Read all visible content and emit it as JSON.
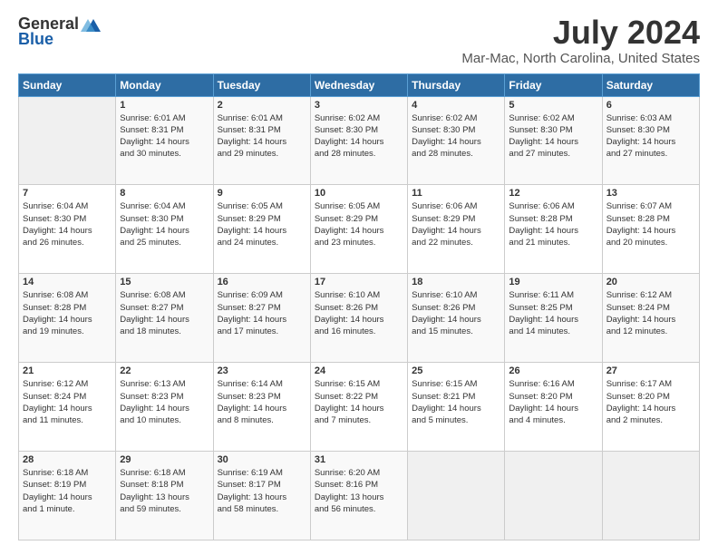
{
  "logo": {
    "general": "General",
    "blue": "Blue"
  },
  "title": "July 2024",
  "subtitle": "Mar-Mac, North Carolina, United States",
  "headers": [
    "Sunday",
    "Monday",
    "Tuesday",
    "Wednesday",
    "Thursday",
    "Friday",
    "Saturday"
  ],
  "weeks": [
    [
      {
        "day": "",
        "info": ""
      },
      {
        "day": "1",
        "info": "Sunrise: 6:01 AM\nSunset: 8:31 PM\nDaylight: 14 hours\nand 30 minutes."
      },
      {
        "day": "2",
        "info": "Sunrise: 6:01 AM\nSunset: 8:31 PM\nDaylight: 14 hours\nand 29 minutes."
      },
      {
        "day": "3",
        "info": "Sunrise: 6:02 AM\nSunset: 8:30 PM\nDaylight: 14 hours\nand 28 minutes."
      },
      {
        "day": "4",
        "info": "Sunrise: 6:02 AM\nSunset: 8:30 PM\nDaylight: 14 hours\nand 28 minutes."
      },
      {
        "day": "5",
        "info": "Sunrise: 6:02 AM\nSunset: 8:30 PM\nDaylight: 14 hours\nand 27 minutes."
      },
      {
        "day": "6",
        "info": "Sunrise: 6:03 AM\nSunset: 8:30 PM\nDaylight: 14 hours\nand 27 minutes."
      }
    ],
    [
      {
        "day": "7",
        "info": "Sunrise: 6:04 AM\nSunset: 8:30 PM\nDaylight: 14 hours\nand 26 minutes."
      },
      {
        "day": "8",
        "info": "Sunrise: 6:04 AM\nSunset: 8:30 PM\nDaylight: 14 hours\nand 25 minutes."
      },
      {
        "day": "9",
        "info": "Sunrise: 6:05 AM\nSunset: 8:29 PM\nDaylight: 14 hours\nand 24 minutes."
      },
      {
        "day": "10",
        "info": "Sunrise: 6:05 AM\nSunset: 8:29 PM\nDaylight: 14 hours\nand 23 minutes."
      },
      {
        "day": "11",
        "info": "Sunrise: 6:06 AM\nSunset: 8:29 PM\nDaylight: 14 hours\nand 22 minutes."
      },
      {
        "day": "12",
        "info": "Sunrise: 6:06 AM\nSunset: 8:28 PM\nDaylight: 14 hours\nand 21 minutes."
      },
      {
        "day": "13",
        "info": "Sunrise: 6:07 AM\nSunset: 8:28 PM\nDaylight: 14 hours\nand 20 minutes."
      }
    ],
    [
      {
        "day": "14",
        "info": "Sunrise: 6:08 AM\nSunset: 8:28 PM\nDaylight: 14 hours\nand 19 minutes."
      },
      {
        "day": "15",
        "info": "Sunrise: 6:08 AM\nSunset: 8:27 PM\nDaylight: 14 hours\nand 18 minutes."
      },
      {
        "day": "16",
        "info": "Sunrise: 6:09 AM\nSunset: 8:27 PM\nDaylight: 14 hours\nand 17 minutes."
      },
      {
        "day": "17",
        "info": "Sunrise: 6:10 AM\nSunset: 8:26 PM\nDaylight: 14 hours\nand 16 minutes."
      },
      {
        "day": "18",
        "info": "Sunrise: 6:10 AM\nSunset: 8:26 PM\nDaylight: 14 hours\nand 15 minutes."
      },
      {
        "day": "19",
        "info": "Sunrise: 6:11 AM\nSunset: 8:25 PM\nDaylight: 14 hours\nand 14 minutes."
      },
      {
        "day": "20",
        "info": "Sunrise: 6:12 AM\nSunset: 8:24 PM\nDaylight: 14 hours\nand 12 minutes."
      }
    ],
    [
      {
        "day": "21",
        "info": "Sunrise: 6:12 AM\nSunset: 8:24 PM\nDaylight: 14 hours\nand 11 minutes."
      },
      {
        "day": "22",
        "info": "Sunrise: 6:13 AM\nSunset: 8:23 PM\nDaylight: 14 hours\nand 10 minutes."
      },
      {
        "day": "23",
        "info": "Sunrise: 6:14 AM\nSunset: 8:23 PM\nDaylight: 14 hours\nand 8 minutes."
      },
      {
        "day": "24",
        "info": "Sunrise: 6:15 AM\nSunset: 8:22 PM\nDaylight: 14 hours\nand 7 minutes."
      },
      {
        "day": "25",
        "info": "Sunrise: 6:15 AM\nSunset: 8:21 PM\nDaylight: 14 hours\nand 5 minutes."
      },
      {
        "day": "26",
        "info": "Sunrise: 6:16 AM\nSunset: 8:20 PM\nDaylight: 14 hours\nand 4 minutes."
      },
      {
        "day": "27",
        "info": "Sunrise: 6:17 AM\nSunset: 8:20 PM\nDaylight: 14 hours\nand 2 minutes."
      }
    ],
    [
      {
        "day": "28",
        "info": "Sunrise: 6:18 AM\nSunset: 8:19 PM\nDaylight: 14 hours\nand 1 minute."
      },
      {
        "day": "29",
        "info": "Sunrise: 6:18 AM\nSunset: 8:18 PM\nDaylight: 13 hours\nand 59 minutes."
      },
      {
        "day": "30",
        "info": "Sunrise: 6:19 AM\nSunset: 8:17 PM\nDaylight: 13 hours\nand 58 minutes."
      },
      {
        "day": "31",
        "info": "Sunrise: 6:20 AM\nSunset: 8:16 PM\nDaylight: 13 hours\nand 56 minutes."
      },
      {
        "day": "",
        "info": ""
      },
      {
        "day": "",
        "info": ""
      },
      {
        "day": "",
        "info": ""
      }
    ]
  ]
}
